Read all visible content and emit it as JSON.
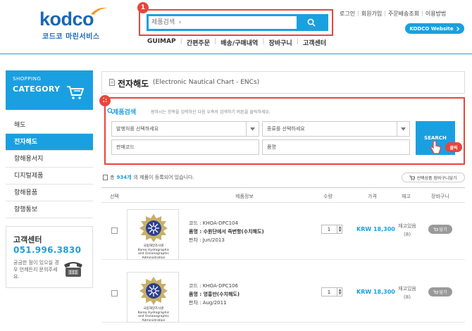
{
  "logo": {
    "word": "kodco",
    "sub": "코드코 마린서비스"
  },
  "search": {
    "placeholder": "제품검색  ›",
    "badge": "1"
  },
  "nav": [
    "GUIMAP",
    "간편주문",
    "배송/구매내역",
    "장바구니",
    "고객센터"
  ],
  "top_links": [
    "로그인",
    "회원가입",
    "주문배송조회",
    "이용방법"
  ],
  "kodco_website": "KODCO Website",
  "sidebar": {
    "header_small": "SHOPPING",
    "header_big": "CATEGORY",
    "items": [
      "해도",
      "전자해도",
      "항해용서지",
      "디지털제품",
      "항해용품",
      "항행통보"
    ],
    "active_index": 1
  },
  "customer_center": {
    "title": "고객센터",
    "phone": "051.996.3830",
    "text": "궁금한 점이 있으실 경우 언제든지 문의주세요."
  },
  "main": {
    "title": "전자해도",
    "subtitle": "(Electronic Nautical Chart - ENCs)"
  },
  "search_panel": {
    "badge": "2",
    "title": "제품검색",
    "desc": "원하시는 항목을 입력하신 다음 우측의 검색하기 버튼을 클릭하세요.",
    "publisher_placeholder": "발행처를 선택하세요",
    "kind_placeholder": "종류를 선택하세요",
    "code_placeholder": "판매코드",
    "name_placeholder": "품명",
    "search_button": "SEARCH",
    "click_label": "클릭"
  },
  "listing": {
    "count_prefix": "총 ",
    "count": "934개",
    "count_suffix": "의 제품이 등록되어 있습니다.",
    "cart_all_button": "선택상품 장바구니담기",
    "headers": {
      "select": "선택",
      "info": "제품정보",
      "qty": "수량",
      "price": "가격",
      "stock": "재고",
      "cart": "장바구니"
    }
  },
  "products": [
    {
      "emblem_text": "국립해양조사원\nKorea Hydrographic\nand Oceanographic\nAdministration",
      "code_label": "코드 : ",
      "code": "KHOA-DPC104",
      "name_label": "품명 : ",
      "name": "수원단에서 죽변항(수치해도)",
      "edition_label": "판차 : ",
      "edition": "Jun/2013",
      "qty": "1",
      "price": "KRW 18,300",
      "stock_status": "재고있음",
      "stock_count": "(8)",
      "cart_label": "담기"
    },
    {
      "emblem_text": "국립해양조사원\nKorea Hydrographic\nand Oceanographic\nAdministration",
      "code_label": "코드 : ",
      "code": "KHOA-DPC106",
      "name_label": "품명 : ",
      "name": "영흥만(수치해도)",
      "edition_label": "판차 : ",
      "edition": "Aug/2011",
      "qty": "1",
      "price": "KRW 18,300",
      "stock_status": "재고있음",
      "stock_count": "(8)",
      "cart_label": "담기"
    }
  ],
  "colors": {
    "accent": "#1aa0e0",
    "brand": "#1a67b4",
    "highlight": "#e8453c"
  }
}
